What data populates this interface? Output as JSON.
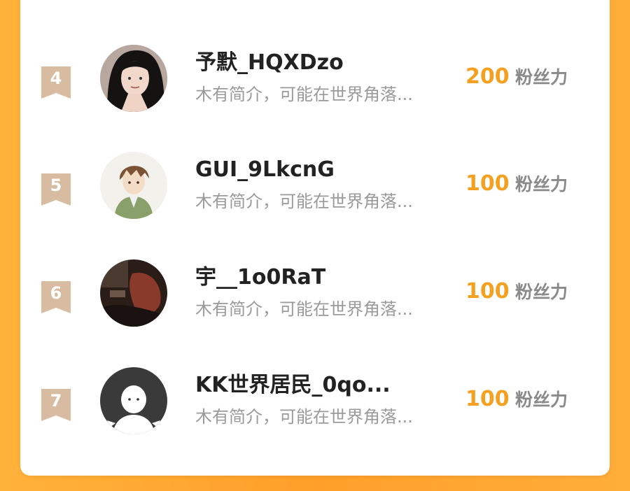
{
  "ranking": {
    "rows": [
      {
        "rank": "4",
        "name": "予默_HQXDzo",
        "desc": "木有简介，可能在世界角落...",
        "score": "200",
        "unit": "粉丝力",
        "avatar": "woman-portrait-avatar"
      },
      {
        "rank": "5",
        "name": "GUI_9LkcnG",
        "desc": "木有简介，可能在世界角落...",
        "score": "100",
        "unit": "粉丝力",
        "avatar": "anime-boy-avatar"
      },
      {
        "rank": "6",
        "name": "宇__1o0RaT",
        "desc": "木有简介，可能在世界角落...",
        "score": "100",
        "unit": "粉丝力",
        "avatar": "dark-photo-avatar"
      },
      {
        "rank": "7",
        "name": "KK世界居民_0qo...",
        "desc": "木有简介，可能在世界角落...",
        "score": "100",
        "unit": "粉丝力",
        "avatar": "default-user-avatar"
      }
    ]
  },
  "colors": {
    "background": "#ff9f2a",
    "card": "#ffffff",
    "score": "#f4a020",
    "badge": "#d8bca2"
  }
}
